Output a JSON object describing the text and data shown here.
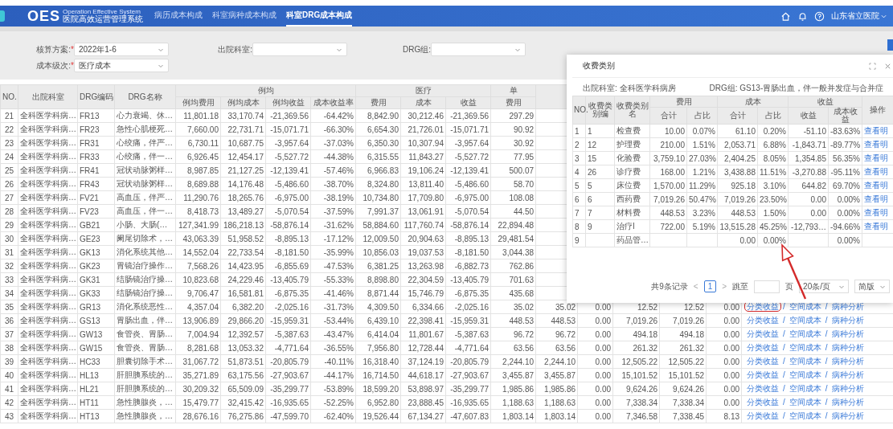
{
  "header": {
    "logo": "OES",
    "logo_en": "Operation Effective System",
    "logo_cn": "医院高效运营管理系统",
    "nav": [
      {
        "label": "病历成本构成",
        "selected": false
      },
      {
        "label": "科室病种成本构成",
        "selected": false
      },
      {
        "label": "科室DRG成本构成",
        "selected": true
      }
    ],
    "user": "山东省立医院"
  },
  "filters": [
    [
      {
        "label": "核算方案:",
        "marker": "*",
        "value": "2022年1-6"
      },
      {
        "label": "出院科室:"
      },
      {
        "label": "DRG组:"
      }
    ],
    [
      {
        "label": "成本级次:",
        "marker": "*",
        "value": "医疗成本"
      }
    ]
  ],
  "table": {
    "columns": [
      {
        "label": "NO."
      },
      {
        "label": "出院科室"
      },
      {
        "label": "DRG编码"
      },
      {
        "label": "DRG名称"
      },
      {
        "label": "例均",
        "columns": [
          {
            "label": "例均费用"
          },
          {
            "label": "例均成本"
          },
          {
            "label": "例均收益"
          },
          {
            "label": "成本收益率"
          }
        ]
      },
      {
        "label": "医疗",
        "columns": [
          {
            "label": "费用"
          },
          {
            "label": "成本"
          },
          {
            "label": "收益"
          }
        ]
      },
      {
        "label": "单",
        "columns": [
          {
            "label": "费用"
          }
        ]
      }
    ],
    "rows": [
      {
        "no": "21",
        "dept": "全科医学科病…",
        "code": "FR13",
        "name": "心力衰竭、休…",
        "values": [
          "11,801.18",
          "33,170.74",
          "-21,369.56",
          "-64.42%",
          "8,842.90",
          "30,212.46",
          "-21,369.56",
          "297.29"
        ]
      },
      {
        "no": "22",
        "dept": "全科医学科病…",
        "code": "FR23",
        "name": "急性心肌梗死…",
        "values": [
          "7,660.00",
          "22,731.71",
          "-15,071.71",
          "-66.30%",
          "6,654.30",
          "21,726.01",
          "-15,071.71",
          "90.92"
        ]
      },
      {
        "no": "23",
        "dept": "全科医学科病…",
        "code": "FR31",
        "name": "心绞痛，伴严…",
        "values": [
          "6,730.11",
          "10,687.75",
          "-3,957.64",
          "-37.03%",
          "6,350.30",
          "10,307.94",
          "-3,957.64",
          "30.92"
        ]
      },
      {
        "no": "24",
        "dept": "全科医学科病…",
        "code": "FR33",
        "name": "心绞痛，伴一…",
        "values": [
          "6,926.45",
          "12,454.17",
          "-5,527.72",
          "-44.38%",
          "6,315.55",
          "11,843.27",
          "-5,527.72",
          "77.95"
        ]
      },
      {
        "no": "25",
        "dept": "全科医学科病…",
        "code": "FR41",
        "name": "冠状动脉粥样…",
        "values": [
          "8,987.85",
          "21,127.25",
          "-12,139.41",
          "-57.46%",
          "6,966.83",
          "19,106.24",
          "-12,139.41",
          "500.07"
        ]
      },
      {
        "no": "26",
        "dept": "全科医学科病…",
        "code": "FR43",
        "name": "冠状动脉粥样…",
        "values": [
          "8,689.88",
          "14,176.48",
          "-5,486.60",
          "-38.70%",
          "8,324.80",
          "13,811.40",
          "-5,486.60",
          "58.70"
        ]
      },
      {
        "no": "27",
        "dept": "全科医学科病…",
        "code": "FV21",
        "name": "高血压，伴严…",
        "values": [
          "11,290.76",
          "18,265.76",
          "-6,975.00",
          "-38.19%",
          "10,734.80",
          "17,709.80",
          "-6,975.00",
          "108.08"
        ]
      },
      {
        "no": "28",
        "dept": "全科医学科病…",
        "code": "FV23",
        "name": "高血压，伴一…",
        "values": [
          "8,418.73",
          "13,489.27",
          "-5,070.54",
          "-37.59%",
          "7,991.37",
          "13,061.91",
          "-5,070.54",
          "44.50"
        ]
      },
      {
        "no": "29",
        "dept": "全科医学科病…",
        "code": "GB21",
        "name": "小肠、大肠(…",
        "values": [
          "127,341.99",
          "186,218.13",
          "-58,876.14",
          "-31.62%",
          "58,884.60",
          "117,760.74",
          "-58,876.14",
          "22,894.48"
        ]
      },
      {
        "no": "30",
        "dept": "全科医学科病…",
        "code": "GE23",
        "name": "阑尾切除术，…",
        "values": [
          "43,063.39",
          "51,958.52",
          "-8,895.13",
          "-17.12%",
          "12,009.50",
          "20,904.63",
          "-8,895.13",
          "29,481.54"
        ]
      },
      {
        "no": "31",
        "dept": "全科医学科病…",
        "code": "GK13",
        "name": "消化系统其他…",
        "values": [
          "14,552.04",
          "22,733.54",
          "-8,181.50",
          "-35.99%",
          "10,856.03",
          "19,037.53",
          "-8,181.50",
          "3,044.38"
        ]
      },
      {
        "no": "32",
        "dept": "全科医学科病…",
        "code": "GK23",
        "name": "胃镜治疗操作…",
        "values": [
          "7,568.26",
          "14,423.95",
          "-6,855.69",
          "-47.53%",
          "6,381.25",
          "13,263.98",
          "-6,882.73",
          "762.86"
        ]
      },
      {
        "no": "33",
        "dept": "全科医学科病…",
        "code": "GK31",
        "name": "结肠镜治疗操…",
        "values": [
          "10,823.68",
          "24,229.46",
          "-13,405.79",
          "-55.33%",
          "8,898.80",
          "22,304.59",
          "-13,405.79",
          "701.63"
        ]
      },
      {
        "no": "34",
        "dept": "全科医学科病…",
        "code": "GK33",
        "name": "结肠镜治疗操…",
        "values": [
          "9,706.47",
          "16,581.81",
          "-6,875.35",
          "-41.46%",
          "8,871.44",
          "15,746.79",
          "-6,875.35",
          "435.68"
        ]
      },
      {
        "no": "35",
        "dept": "全科医学科病…",
        "code": "GR13",
        "name": "消化系统恶性…",
        "values": [
          "4,357.04",
          "6,382.20",
          "-2,025.16",
          "-31.73%",
          "4,309.50",
          "6,334.66",
          "-2,025.16",
          "35.02"
        ],
        "more": [
          "35.02",
          "0.00",
          "12.52",
          "12.52",
          "0.00"
        ],
        "ops": [
          {
            "kind": "link",
            "label": "分类收益",
            "circled": true
          },
          {
            "kind": "separator",
            "label": "/"
          },
          {
            "kind": "link",
            "label": "空间成本",
            "circled": false
          },
          {
            "kind": "separator",
            "label": "/"
          },
          {
            "kind": "link",
            "label": "病种分析",
            "circled": false
          }
        ]
      },
      {
        "no": "36",
        "dept": "全科医学科病…",
        "code": "GS13",
        "name": "胃肠出血，伴…",
        "values": [
          "13,906.89",
          "29,866.20",
          "-15,959.31",
          "-53.44%",
          "6,439.10",
          "22,398.41",
          "-15,959.31",
          "448.53"
        ],
        "more": [
          "448.53",
          "0.00",
          "7,019.26",
          "7,019.26",
          "0.00"
        ],
        "ops": [
          {
            "kind": "link",
            "label": "分类收益",
            "circled": false
          },
          {
            "kind": "separator",
            "label": "/"
          },
          {
            "kind": "link",
            "label": "空间成本",
            "circled": false
          },
          {
            "kind": "separator",
            "label": "/"
          },
          {
            "kind": "link",
            "label": "病种分析",
            "circled": false
          }
        ]
      },
      {
        "no": "37",
        "dept": "全科医学科病…",
        "code": "GW13",
        "name": "食管炎、胃肠…",
        "values": [
          "7,004.94",
          "12,392.57",
          "-5,387.63",
          "-43.47%",
          "6,414.04",
          "11,801.67",
          "-5,387.63",
          "96.72"
        ],
        "more": [
          "96.72",
          "0.00",
          "494.18",
          "494.18",
          "0.00"
        ],
        "ops": [
          {
            "kind": "link",
            "label": "分类收益",
            "circled": false
          },
          {
            "kind": "separator",
            "label": "/"
          },
          {
            "kind": "link",
            "label": "空间成本",
            "circled": false
          },
          {
            "kind": "separator",
            "label": "/"
          },
          {
            "kind": "link",
            "label": "病种分析",
            "circled": false
          }
        ]
      },
      {
        "no": "38",
        "dept": "全科医学科病…",
        "code": "GW15",
        "name": "食管炎、胃肠…",
        "values": [
          "8,281.68",
          "13,053.32",
          "-4,771.64",
          "-36.55%",
          "7,956.80",
          "12,728.44",
          "-4,771.64",
          "63.56"
        ],
        "more": [
          "63.56",
          "0.00",
          "261.32",
          "261.32",
          "0.00"
        ],
        "ops": [
          {
            "kind": "link",
            "label": "分类收益",
            "circled": false
          },
          {
            "kind": "separator",
            "label": "/"
          },
          {
            "kind": "link",
            "label": "空间成本",
            "circled": false
          },
          {
            "kind": "separator",
            "label": "/"
          },
          {
            "kind": "link",
            "label": "病种分析",
            "circled": false
          }
        ]
      },
      {
        "no": "39",
        "dept": "全科医学科病…",
        "code": "HC33",
        "name": "胆囊切除手术…",
        "values": [
          "31,067.72",
          "51,873.51",
          "-20,805.79",
          "-40.11%",
          "16,318.40",
          "37,124.19",
          "-20,805.79",
          "2,244.10"
        ],
        "more": [
          "2,244.10",
          "0.00",
          "12,505.22",
          "12,505.22",
          "0.00"
        ],
        "ops": [
          {
            "kind": "link",
            "label": "分类收益",
            "circled": false
          },
          {
            "kind": "separator",
            "label": "/"
          },
          {
            "kind": "link",
            "label": "空间成本",
            "circled": false
          },
          {
            "kind": "separator",
            "label": "/"
          },
          {
            "kind": "link",
            "label": "病种分析",
            "circled": false
          }
        ]
      },
      {
        "no": "40",
        "dept": "全科医学科病…",
        "code": "HL13",
        "name": "肝胆胰系统的…",
        "values": [
          "35,271.89",
          "63,175.56",
          "-27,903.67",
          "-44.17%",
          "16,714.50",
          "44,618.17",
          "-27,903.67",
          "3,455.87"
        ],
        "more": [
          "3,455.87",
          "0.00",
          "15,101.52",
          "15,101.52",
          "0.00"
        ],
        "ops": [
          {
            "kind": "link",
            "label": "分类收益",
            "circled": false
          },
          {
            "kind": "separator",
            "label": "/"
          },
          {
            "kind": "link",
            "label": "空间成本",
            "circled": false
          },
          {
            "kind": "separator",
            "label": "/"
          },
          {
            "kind": "link",
            "label": "病种分析",
            "circled": false
          }
        ]
      },
      {
        "no": "41",
        "dept": "全科医学科病…",
        "code": "HL21",
        "name": "肝胆胰系统的…",
        "values": [
          "30,209.32",
          "65,509.09",
          "-35,299.77",
          "-53.89%",
          "18,599.20",
          "53,898.97",
          "-35,299.77",
          "1,985.86"
        ],
        "more": [
          "1,985.86",
          "0.00",
          "9,624.26",
          "9,624.26",
          "0.00"
        ],
        "ops": [
          {
            "kind": "link",
            "label": "分类收益",
            "circled": false
          },
          {
            "kind": "separator",
            "label": "/"
          },
          {
            "kind": "link",
            "label": "空间成本",
            "circled": false
          },
          {
            "kind": "separator",
            "label": "/"
          },
          {
            "kind": "link",
            "label": "病种分析",
            "circled": false
          }
        ]
      },
      {
        "no": "42",
        "dept": "全科医学科病…",
        "code": "HT11",
        "name": "急性胰腺炎，…",
        "values": [
          "15,479.77",
          "32,415.42",
          "-16,935.65",
          "-52.25%",
          "6,952.80",
          "23,888.45",
          "-16,935.65",
          "1,188.63"
        ],
        "more": [
          "1,188.63",
          "0.00",
          "7,338.34",
          "7,338.34",
          "0.00"
        ],
        "ops": [
          {
            "kind": "link",
            "label": "分类收益",
            "circled": false
          },
          {
            "kind": "separator",
            "label": "/"
          },
          {
            "kind": "link",
            "label": "空间成本",
            "circled": false
          },
          {
            "kind": "separator",
            "label": "/"
          },
          {
            "kind": "link",
            "label": "病种分析",
            "circled": false
          }
        ]
      },
      {
        "no": "43",
        "dept": "全科医学科病…",
        "code": "HT13",
        "name": "急性胰腺炎，…",
        "values": [
          "28,676.16",
          "76,275.86",
          "-47,599.70",
          "-62.40%",
          "19,526.44",
          "67,134.27",
          "-47,607.83",
          "1,803.14"
        ],
        "more": [
          "1,803.14",
          "0.00",
          "7,346.58",
          "7,338.45",
          "8.13"
        ],
        "ops": [
          {
            "kind": "link",
            "label": "分类收益",
            "circled": false
          },
          {
            "kind": "separator",
            "label": "/"
          },
          {
            "kind": "link",
            "label": "空间成本",
            "circled": false
          },
          {
            "kind": "separator",
            "label": "/"
          },
          {
            "kind": "link",
            "label": "病种分析",
            "circled": false
          }
        ]
      }
    ]
  },
  "popup": {
    "title": "收费类别",
    "info": [
      {
        "label": "出院科室:",
        "value": "全科医学科病房"
      },
      {
        "label": "DRG组:",
        "value": "GS13-胃肠出血，伴一般并发症与合并症"
      }
    ],
    "columns": [
      {
        "label": "NO."
      },
      {
        "label": "收费类别编"
      },
      {
        "label": "收费类别名"
      },
      {
        "label": "费用",
        "colspan": 2,
        "columns": [
          {
            "label": "合计"
          },
          {
            "label": "占比"
          }
        ]
      },
      {
        "label": "成本",
        "colspan": 2,
        "columns": [
          {
            "label": "合计"
          },
          {
            "label": "占比"
          }
        ]
      },
      {
        "label": "收益",
        "colspan": 2,
        "columns": [
          {
            "label": "收益"
          },
          {
            "label": "成本收益"
          }
        ]
      },
      {
        "label": "操作"
      }
    ],
    "rows": [
      {
        "cells": [
          "1",
          "1",
          "检查费",
          "10.00",
          "0.07%",
          "61.10",
          "0.20%",
          "-51.10",
          "-83.63%",
          "查看明"
        ]
      },
      {
        "cells": [
          "2",
          "12",
          "护理费",
          "210.00",
          "1.51%",
          "2,053.71",
          "6.88%",
          "-1,843.71",
          "-89.77%",
          "查看明"
        ]
      },
      {
        "cells": [
          "3",
          "15",
          "化验费",
          "3,759.10",
          "27.03%",
          "2,404.25",
          "8.05%",
          "1,354.85",
          "56.35%",
          "查看明"
        ]
      },
      {
        "cells": [
          "4",
          "26",
          "诊疗费",
          "168.00",
          "1.21%",
          "3,438.88",
          "11.51%",
          "-3,270.88",
          "-95.11%",
          "查看明"
        ]
      },
      {
        "cells": [
          "5",
          "5",
          "床位费",
          "1,570.00",
          "11.29%",
          "925.18",
          "3.10%",
          "644.82",
          "69.70%",
          "查看明"
        ]
      },
      {
        "cells": [
          "6",
          "6",
          "西药费",
          "7,019.26",
          "50.47%",
          "7,019.26",
          "23.50%",
          "0.00",
          "0.00%",
          "查看明"
        ]
      },
      {
        "cells": [
          "7",
          "7",
          "材料费",
          "448.53",
          "3.23%",
          "448.53",
          "1.50%",
          "0.00",
          "0.00%",
          "查看明"
        ]
      },
      {
        "cells": [
          "8",
          "9",
          "治疗I",
          "722.00",
          "5.19%",
          "13,515.28",
          "45.25%",
          "-12,793…",
          "-94.66%",
          "查看明"
        ]
      },
      {
        "cells": [
          "9",
          null,
          "药品管…",
          null,
          null,
          "0.00",
          "0.00%",
          null,
          "0.00%",
          null
        ]
      }
    ],
    "pagination": {
      "total": "共9条记录",
      "prev": "<",
      "pages": [
        {
          "label": "1",
          "selected": true
        }
      ],
      "next": ">",
      "jump_label": "跳至",
      "jump_unit": "页",
      "page_size": "20条/页",
      "mode": "简版"
    }
  }
}
